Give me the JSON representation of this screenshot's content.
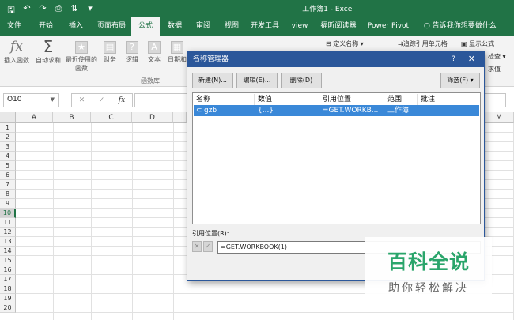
{
  "window": {
    "title": "工作簿1  -  Excel"
  },
  "quick_access": {
    "save_icon": "save-icon",
    "undo_icon": "undo-icon",
    "redo_icon": "redo-icon",
    "preview_icon": "print-preview-icon",
    "sort_icon": "sort-icon",
    "customize_icon": "customize-qat-icon"
  },
  "tabs": [
    "文件",
    "开始",
    "插入",
    "页面布局",
    "公式",
    "数据",
    "审阅",
    "视图",
    "开发工具",
    "view",
    "福昕阅读器",
    "Power Pivot"
  ],
  "active_tab": "公式",
  "tell_me": "告诉我你想要做什么",
  "ribbon": {
    "insert_function": "插入函数",
    "autosum": "自动求和",
    "recent": "最近使用的函数",
    "financial": "财务",
    "logical": "逻辑",
    "text": "文本",
    "datetime": "日期和",
    "function_library": "函数库",
    "define_name": "定义名称",
    "trace_precedents": "追踪引用单元格",
    "show_formulas": "显示公式",
    "check_partial": "检查",
    "value_partial": "求值"
  },
  "formula_bar": {
    "name_box": "O10",
    "fx": "fx",
    "cancel": "✕",
    "enter": "✓",
    "value": ""
  },
  "grid": {
    "columns": [
      "A",
      "B",
      "C",
      "D",
      "M"
    ],
    "rows": [
      "1",
      "2",
      "3",
      "4",
      "5",
      "6",
      "7",
      "8",
      "9",
      "10",
      "11",
      "12",
      "13",
      "14",
      "15",
      "16",
      "17",
      "18",
      "19",
      "20"
    ],
    "selected_row": "10"
  },
  "dialog": {
    "title": "名称管理器",
    "help": "?",
    "close": "✕",
    "buttons": {
      "new": "新建(N)...",
      "edit": "编辑(E)...",
      "delete": "删除(D)",
      "filter": "筛选(F) ▾"
    },
    "columns": [
      "名称",
      "数值",
      "引用位置",
      "范围",
      "批注"
    ],
    "rows": [
      {
        "name": "gzb",
        "value": "{...}",
        "refers_to": "=GET.WORKB...",
        "scope": "工作簿",
        "comment": ""
      }
    ],
    "refers_to_label": "引用位置(R):",
    "refers_to_value": "=GET.WORKBOOK(1)"
  },
  "watermark": {
    "title": "百科全说",
    "subtitle": "助你轻松解决"
  },
  "colors": {
    "excel_green": "#217346",
    "dialog_blue": "#2b579a",
    "selection": "#3a88d8",
    "watermark_green": "#2aa56b"
  }
}
